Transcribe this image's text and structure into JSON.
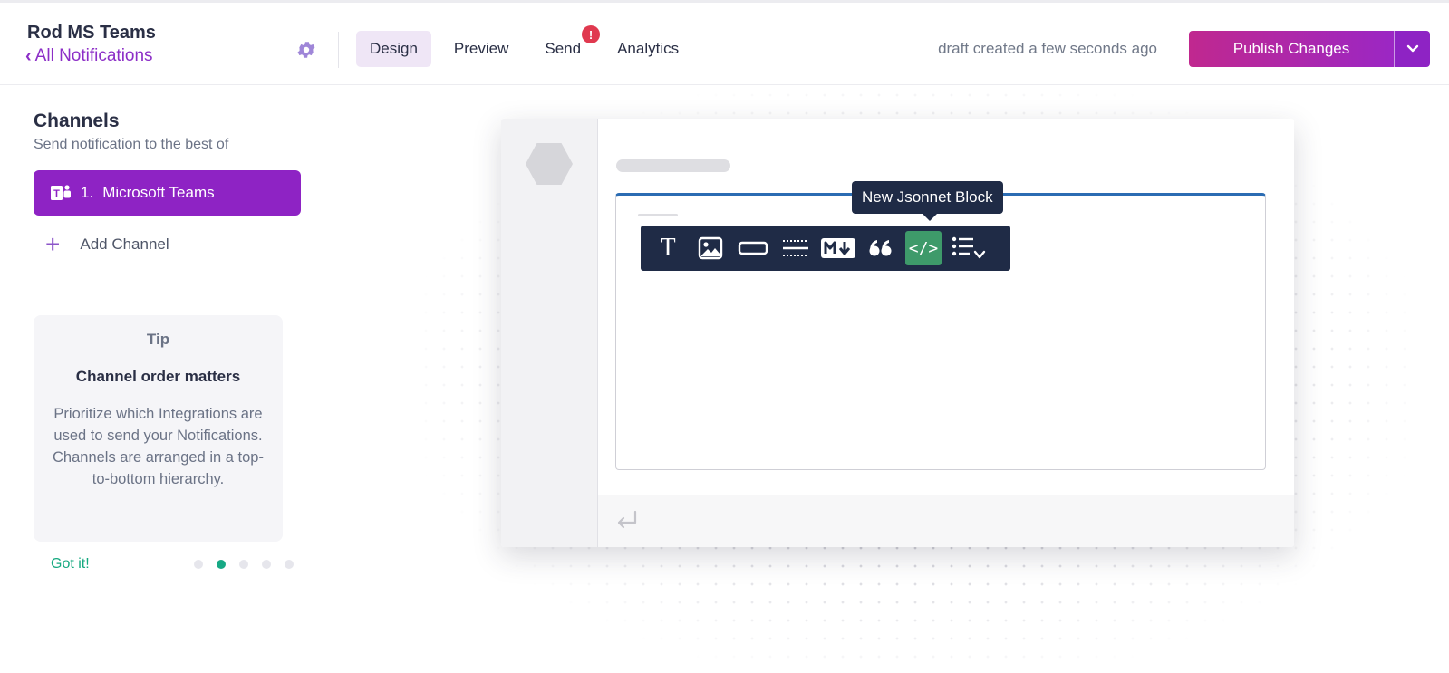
{
  "header": {
    "app_title": "Rod MS Teams",
    "back_link": "All Notifications",
    "tabs": [
      {
        "label": "Design",
        "active": true
      },
      {
        "label": "Preview",
        "active": false
      },
      {
        "label": "Send",
        "active": false,
        "badge": "!"
      },
      {
        "label": "Analytics",
        "active": false
      }
    ],
    "draft_status": "draft created a few seconds ago",
    "publish_label": "Publish Changes"
  },
  "sidebar": {
    "title": "Channels",
    "subtitle": "Send notification to the best of",
    "channels": [
      {
        "index": "1.",
        "name": "Microsoft Teams",
        "icon": "microsoft-teams-icon"
      }
    ],
    "add_channel": "Add Channel",
    "tip": {
      "label": "Tip",
      "heading": "Channel order matters",
      "body": "Prioritize which Integrations are used to send your Notifications. Channels are arranged in a top-to-bottom hierarchy.",
      "dismiss": "Got it!",
      "total_pages": 5,
      "current_page": 2
    }
  },
  "editor": {
    "tooltip": "New Jsonnet Block",
    "toolbar_icons": [
      "text-block-icon",
      "image-block-icon",
      "action-button-icon",
      "divider-icon",
      "markdown-icon",
      "quote-icon",
      "jsonnet-code-icon",
      "list-icon"
    ],
    "code_glyph": "</>",
    "text_glyph": "T"
  },
  "colors": {
    "brand_purple": "#8e23c4",
    "publish_gradient_start": "#c0288f",
    "tip_accent": "#16a980",
    "toolbar_bg": "#1f2b46",
    "active_tool": "#3e9a6a",
    "alert_red": "#e0394f"
  }
}
